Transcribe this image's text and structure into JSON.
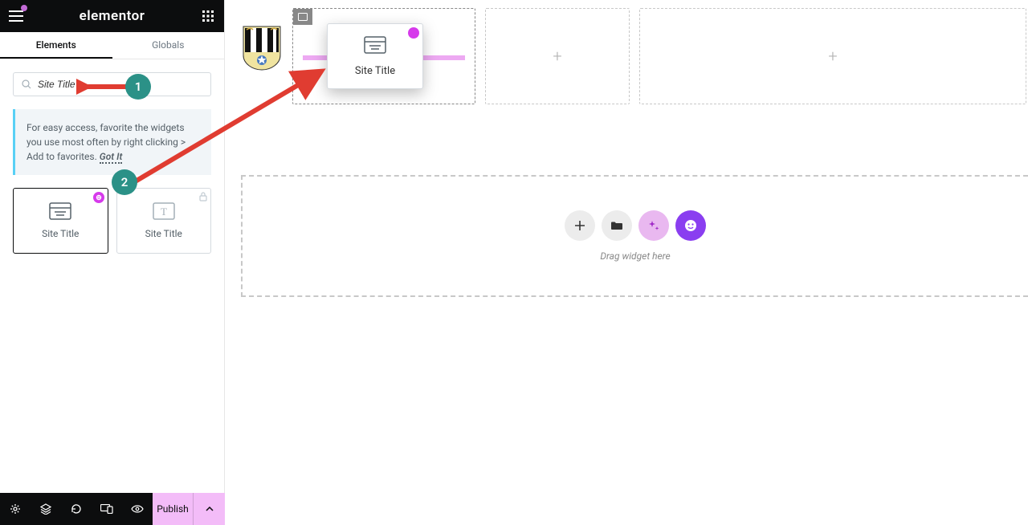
{
  "brand": "elementor",
  "tabs": {
    "elements": "Elements",
    "globals": "Globals"
  },
  "search": {
    "value": "Site Title"
  },
  "tip": {
    "text": "For easy access, favorite the widgets you use most often by right clicking > Add to favorites.",
    "gotit": "Got It"
  },
  "widgets": {
    "site_title_pro": "Site Title",
    "site_title_locked": "Site Title"
  },
  "publish": "Publish",
  "canvas": {
    "drag_label": "Site Title",
    "drop_hint": "Drag widget here"
  },
  "annotations": {
    "step1": "1",
    "step2": "2"
  }
}
